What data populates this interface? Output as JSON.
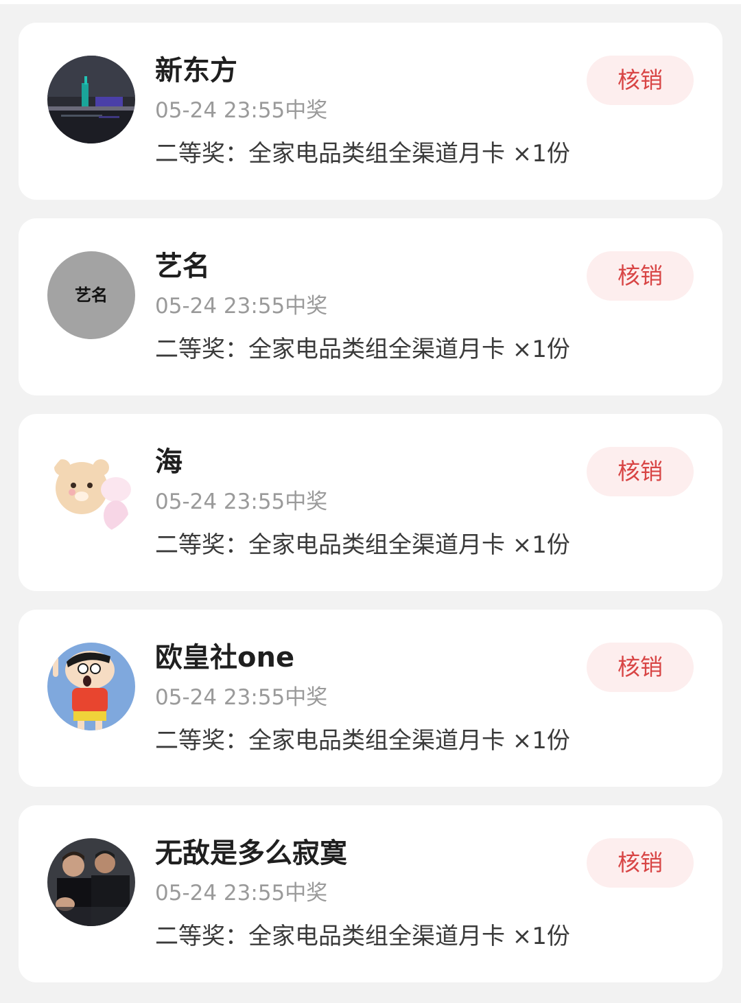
{
  "redeem_label": "核销",
  "accent_color": "#d84545",
  "winners": [
    {
      "name": "新东方",
      "time": "05-24 23:55中奖",
      "prize": "二等奖：全家电品类组全渠道月卡 ×1份",
      "avatar": "night-city-photo"
    },
    {
      "name": "艺名",
      "time": "05-24 23:55中奖",
      "prize": "二等奖：全家电品类组全渠道月卡 ×1份",
      "avatar": "calligraphy-text-avatar",
      "avatar_text": "艺名"
    },
    {
      "name": "海",
      "time": "05-24 23:55中奖",
      "prize": "二等奖：全家电品类组全渠道月卡 ×1份",
      "avatar": "cartoon-bear-avatar"
    },
    {
      "name": "欧皇社one",
      "time": "05-24 23:55中奖",
      "prize": "二等奖：全家电品类组全渠道月卡 ×1份",
      "avatar": "cartoon-boy-avatar"
    },
    {
      "name": "无敌是多么寂寞",
      "time": "05-24 23:55中奖",
      "prize": "二等奖：全家电品类组全渠道月卡 ×1份",
      "avatar": "people-photo-avatar"
    }
  ]
}
